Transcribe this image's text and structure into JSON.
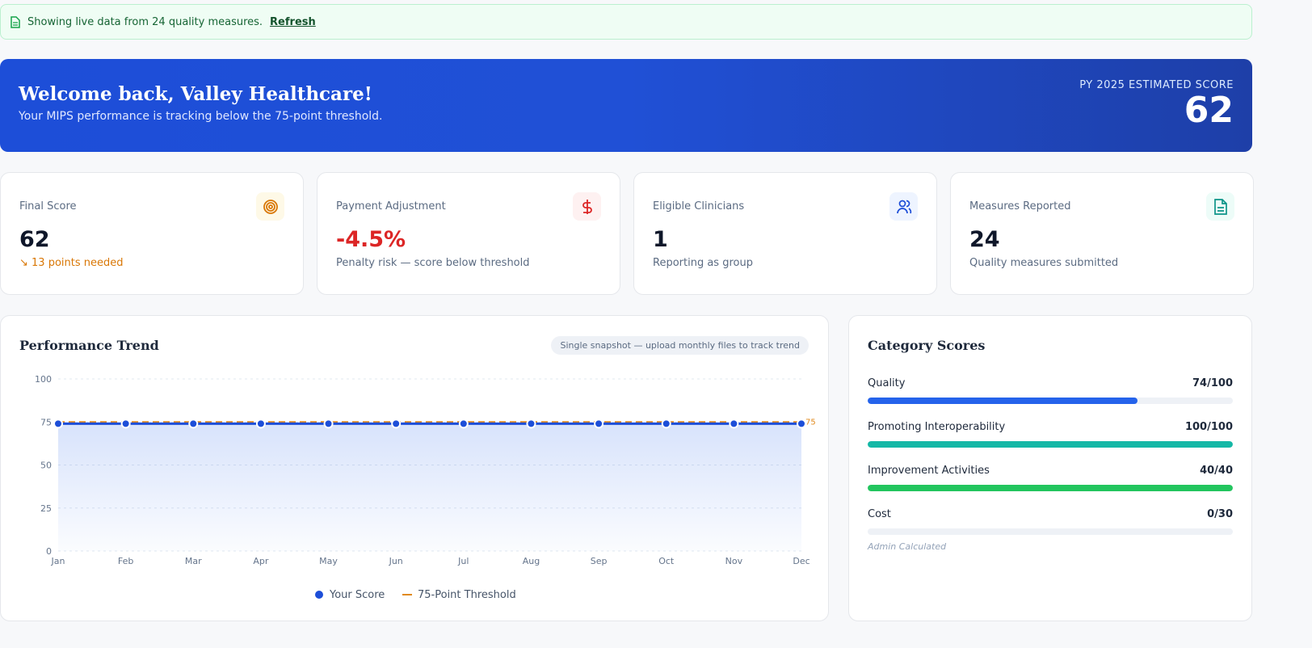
{
  "banner": {
    "icon": "document-icon",
    "text": "Showing live data from 24 quality measures.",
    "link": "Refresh"
  },
  "hero": {
    "title": "Welcome back, Valley Healthcare!",
    "subtitle": "Your MIPS performance is tracking below the 75-point threshold.",
    "score_label": "PY 2025 ESTIMATED SCORE",
    "score": "62"
  },
  "cards": [
    {
      "title": "Final Score",
      "value": "62",
      "sub": "13 points needed",
      "icon": "target-icon",
      "color": "#d97706",
      "bg": "#fef9e7"
    },
    {
      "title": "Payment Adjustment",
      "value": "-4.5%",
      "sub": "Penalty risk — score below threshold",
      "icon": "dollar-icon",
      "color": "#dc2626",
      "bg": "#fef1f1"
    },
    {
      "title": "Eligible Clinicians",
      "value": "1",
      "sub": "Reporting as group",
      "icon": "users-icon",
      "color": "#1d4ed8",
      "bg": "#eef4ff"
    },
    {
      "title": "Measures Reported",
      "value": "24",
      "sub": "Quality measures submitted",
      "icon": "file-icon",
      "color": "#0d9488",
      "bg": "#edfcf8"
    }
  ],
  "trend": {
    "title": "Performance Trend",
    "pill": "Single snapshot — upload monthly files to track trend"
  },
  "chart_data": {
    "type": "line",
    "categories": [
      "Jan",
      "Feb",
      "Mar",
      "Apr",
      "May",
      "Jun",
      "Jul",
      "Aug",
      "Sep",
      "Oct",
      "Nov",
      "Dec"
    ],
    "series": [
      {
        "name": "Your Score",
        "values": [
          74,
          74,
          74,
          74,
          74,
          74,
          74,
          74,
          74,
          74,
          74,
          74
        ],
        "color": "#1d4ed8"
      },
      {
        "name": "75-Point Threshold",
        "values": [
          75,
          75,
          75,
          75,
          75,
          75,
          75,
          75,
          75,
          75,
          75,
          75
        ],
        "color": "#e08a1e"
      }
    ],
    "ylim": [
      0,
      100
    ],
    "yticks": [
      "0",
      "25",
      "50",
      "75",
      "100"
    ],
    "grid": true,
    "legend": "bottom",
    "threshold_label": "75"
  },
  "categories": {
    "title": "Category Scores",
    "items": [
      {
        "name": "Quality",
        "score": "74/100",
        "pct": 74,
        "color": "#2563eb"
      },
      {
        "name": "Promoting Interoperability",
        "score": "100/100",
        "pct": 100,
        "color": "#14b8a6"
      },
      {
        "name": "Improvement Activities",
        "score": "40/40",
        "pct": 100,
        "color": "#22c55e"
      },
      {
        "name": "Cost",
        "score": "0/30",
        "pct": 0,
        "color": "#94a3b8",
        "note": "Admin Calculated"
      }
    ]
  }
}
